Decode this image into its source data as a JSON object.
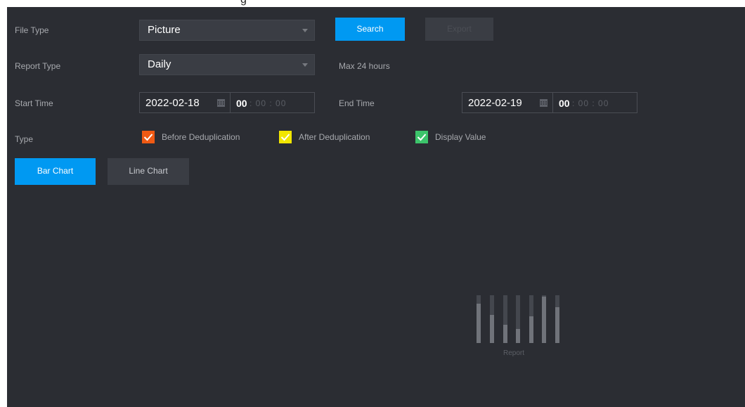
{
  "window": {
    "title_fragment": "g"
  },
  "form": {
    "file_type": {
      "label": "File Type",
      "value": "Picture"
    },
    "report_type": {
      "label": "Report Type",
      "value": "Daily",
      "hint": "Max 24 hours"
    },
    "start_time": {
      "label": "Start Time",
      "date": "2022-02-18",
      "hour": "00",
      "rest": ": 00 : 00"
    },
    "end_time": {
      "label": "End Time",
      "date": "2022-02-19",
      "hour": "00",
      "rest": ": 00 : 00"
    },
    "type": {
      "label": "Type",
      "options": [
        {
          "label": "Before Deduplication",
          "checked": true,
          "color": "#f05a14"
        },
        {
          "label": "After Deduplication",
          "checked": true,
          "color": "#f2e600"
        },
        {
          "label": "Display Value",
          "checked": true,
          "color": "#3cc46b"
        }
      ]
    }
  },
  "buttons": {
    "search": "Search",
    "export": "Export"
  },
  "chart_tabs": {
    "bar": "Bar Chart",
    "line": "Line Chart",
    "active": "bar"
  },
  "empty_state": {
    "caption": "Report",
    "icon": "report-chart-icon"
  },
  "colors": {
    "accent": "#0099f2",
    "panel": "#2b2d33"
  }
}
